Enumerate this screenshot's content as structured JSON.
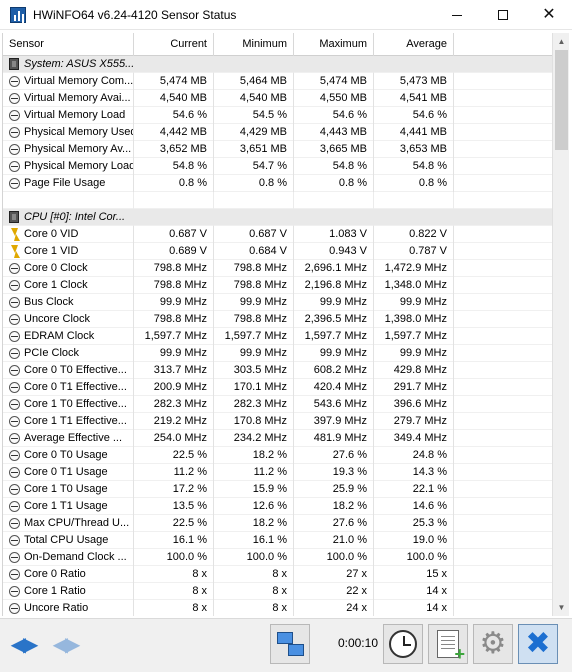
{
  "window": {
    "title": "HWiNFO64 v6.24-4120 Sensor Status",
    "minimize_icon": "minimize-icon",
    "maximize_icon": "maximize-icon",
    "close_icon": "close-icon"
  },
  "columns": [
    "Sensor",
    "Current",
    "Minimum",
    "Maximum",
    "Average"
  ],
  "rows": [
    {
      "type": "group",
      "icon": "chip-icon",
      "name": "System: ASUS X555...",
      "cur": "",
      "min": "",
      "max": "",
      "avg": ""
    },
    {
      "type": "data",
      "icon": "gauge-icon",
      "name": "Virtual Memory Com...",
      "cur": "5,474 MB",
      "min": "5,464 MB",
      "max": "5,474 MB",
      "avg": "5,473 MB"
    },
    {
      "type": "data",
      "icon": "gauge-icon",
      "name": "Virtual Memory Avai...",
      "cur": "4,540 MB",
      "min": "4,540 MB",
      "max": "4,550 MB",
      "avg": "4,541 MB"
    },
    {
      "type": "data",
      "icon": "gauge-icon",
      "name": "Virtual Memory Load",
      "cur": "54.6 %",
      "min": "54.5 %",
      "max": "54.6 %",
      "avg": "54.6 %"
    },
    {
      "type": "data",
      "icon": "gauge-icon",
      "name": "Physical Memory Used",
      "cur": "4,442 MB",
      "min": "4,429 MB",
      "max": "4,443 MB",
      "avg": "4,441 MB"
    },
    {
      "type": "data",
      "icon": "gauge-icon",
      "name": "Physical Memory Av...",
      "cur": "3,652 MB",
      "min": "3,651 MB",
      "max": "3,665 MB",
      "avg": "3,653 MB"
    },
    {
      "type": "data",
      "icon": "gauge-icon",
      "name": "Physical Memory Load",
      "cur": "54.8 %",
      "min": "54.7 %",
      "max": "54.8 %",
      "avg": "54.8 %"
    },
    {
      "type": "data",
      "icon": "gauge-icon",
      "name": "Page File Usage",
      "cur": "0.8 %",
      "min": "0.8 %",
      "max": "0.8 %",
      "avg": "0.8 %"
    },
    {
      "type": "blank",
      "icon": "",
      "name": "",
      "cur": "",
      "min": "",
      "max": "",
      "avg": ""
    },
    {
      "type": "group",
      "icon": "chip-icon",
      "name": "CPU [#0]: Intel Cor...",
      "cur": "",
      "min": "",
      "max": "",
      "avg": ""
    },
    {
      "type": "data",
      "icon": "voltage-icon",
      "name": "Core 0 VID",
      "cur": "0.687 V",
      "min": "0.687 V",
      "max": "1.083 V",
      "avg": "0.822 V"
    },
    {
      "type": "data",
      "icon": "voltage-icon",
      "name": "Core 1 VID",
      "cur": "0.689 V",
      "min": "0.684 V",
      "max": "0.943 V",
      "avg": "0.787 V"
    },
    {
      "type": "data",
      "icon": "gauge-icon",
      "name": "Core 0 Clock",
      "cur": "798.8 MHz",
      "min": "798.8 MHz",
      "max": "2,696.1 MHz",
      "avg": "1,472.9 MHz"
    },
    {
      "type": "data",
      "icon": "gauge-icon",
      "name": "Core 1 Clock",
      "cur": "798.8 MHz",
      "min": "798.8 MHz",
      "max": "2,196.8 MHz",
      "avg": "1,348.0 MHz"
    },
    {
      "type": "data",
      "icon": "gauge-icon",
      "name": "Bus Clock",
      "cur": "99.9 MHz",
      "min": "99.9 MHz",
      "max": "99.9 MHz",
      "avg": "99.9 MHz"
    },
    {
      "type": "data",
      "icon": "gauge-icon",
      "name": "Uncore Clock",
      "cur": "798.8 MHz",
      "min": "798.8 MHz",
      "max": "2,396.5 MHz",
      "avg": "1,398.0 MHz"
    },
    {
      "type": "data",
      "icon": "gauge-icon",
      "name": "EDRAM Clock",
      "cur": "1,597.7 MHz",
      "min": "1,597.7 MHz",
      "max": "1,597.7 MHz",
      "avg": "1,597.7 MHz"
    },
    {
      "type": "data",
      "icon": "gauge-icon",
      "name": "PCIe Clock",
      "cur": "99.9 MHz",
      "min": "99.9 MHz",
      "max": "99.9 MHz",
      "avg": "99.9 MHz"
    },
    {
      "type": "data",
      "icon": "gauge-icon",
      "name": "Core 0 T0 Effective...",
      "cur": "313.7 MHz",
      "min": "303.5 MHz",
      "max": "608.2 MHz",
      "avg": "429.8 MHz"
    },
    {
      "type": "data",
      "icon": "gauge-icon",
      "name": "Core 0 T1 Effective...",
      "cur": "200.9 MHz",
      "min": "170.1 MHz",
      "max": "420.4 MHz",
      "avg": "291.7 MHz"
    },
    {
      "type": "data",
      "icon": "gauge-icon",
      "name": "Core 1 T0 Effective...",
      "cur": "282.3 MHz",
      "min": "282.3 MHz",
      "max": "543.6 MHz",
      "avg": "396.6 MHz"
    },
    {
      "type": "data",
      "icon": "gauge-icon",
      "name": "Core 1 T1 Effective...",
      "cur": "219.2 MHz",
      "min": "170.8 MHz",
      "max": "397.9 MHz",
      "avg": "279.7 MHz"
    },
    {
      "type": "data",
      "icon": "gauge-icon",
      "name": "Average Effective ...",
      "cur": "254.0 MHz",
      "min": "234.2 MHz",
      "max": "481.9 MHz",
      "avg": "349.4 MHz"
    },
    {
      "type": "data",
      "icon": "gauge-icon",
      "name": "Core 0 T0 Usage",
      "cur": "22.5 %",
      "min": "18.2 %",
      "max": "27.6 %",
      "avg": "24.8 %"
    },
    {
      "type": "data",
      "icon": "gauge-icon",
      "name": "Core 0 T1 Usage",
      "cur": "11.2 %",
      "min": "11.2 %",
      "max": "19.3 %",
      "avg": "14.3 %"
    },
    {
      "type": "data",
      "icon": "gauge-icon",
      "name": "Core 1 T0 Usage",
      "cur": "17.2 %",
      "min": "15.9 %",
      "max": "25.9 %",
      "avg": "22.1 %"
    },
    {
      "type": "data",
      "icon": "gauge-icon",
      "name": "Core 1 T1 Usage",
      "cur": "13.5 %",
      "min": "12.6 %",
      "max": "18.2 %",
      "avg": "14.6 %"
    },
    {
      "type": "data",
      "icon": "gauge-icon",
      "name": "Max CPU/Thread U...",
      "cur": "22.5 %",
      "min": "18.2 %",
      "max": "27.6 %",
      "avg": "25.3 %"
    },
    {
      "type": "data",
      "icon": "gauge-icon",
      "name": "Total CPU Usage",
      "cur": "16.1 %",
      "min": "16.1 %",
      "max": "21.0 %",
      "avg": "19.0 %"
    },
    {
      "type": "data",
      "icon": "gauge-icon",
      "name": "On-Demand Clock ...",
      "cur": "100.0 %",
      "min": "100.0 %",
      "max": "100.0 %",
      "avg": "100.0 %"
    },
    {
      "type": "data",
      "icon": "gauge-icon",
      "name": "Core 0 Ratio",
      "cur": "8 x",
      "min": "8 x",
      "max": "27 x",
      "avg": "15 x"
    },
    {
      "type": "data",
      "icon": "gauge-icon",
      "name": "Core 1 Ratio",
      "cur": "8 x",
      "min": "8 x",
      "max": "22 x",
      "avg": "14 x"
    },
    {
      "type": "data",
      "icon": "gauge-icon",
      "name": "Uncore Ratio",
      "cur": "8 x",
      "min": "8 x",
      "max": "24 x",
      "avg": "14 x"
    }
  ],
  "toolbar": {
    "timer": "0:00:10",
    "nav_icon": "navigate-arrows-icon",
    "nav_disabled_icon": "navigate-arrows-disabled-icon",
    "network_icon": "network-icon",
    "clock_icon": "clock-icon",
    "report_icon": "report-add-icon",
    "settings_icon": "gear-icon",
    "close_icon": "close-x-icon"
  }
}
